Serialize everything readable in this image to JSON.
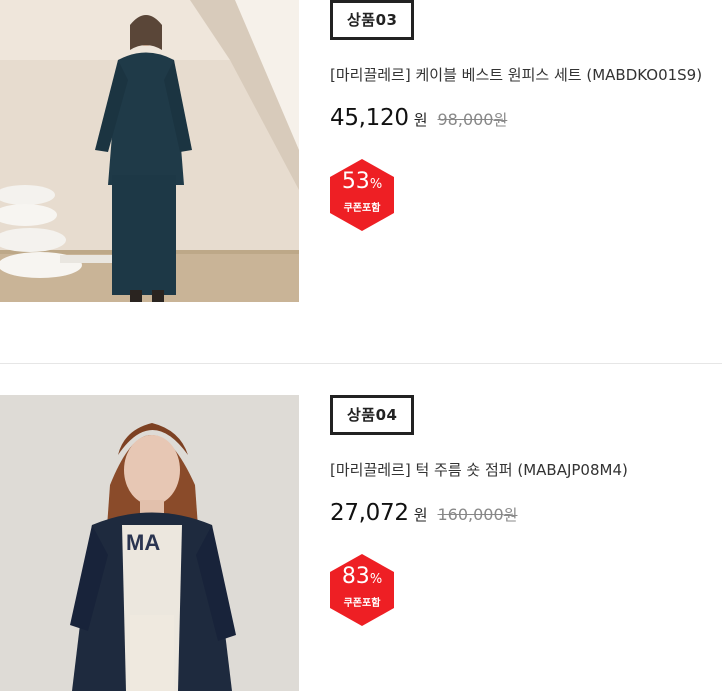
{
  "colors": {
    "discount_badge": "#ee1f24",
    "badge_border": "#222222",
    "divider": "#e6e6e6"
  },
  "products": [
    {
      "tag": "상품03",
      "name": "[마리끌레르] 케이블 베스트 원피스 세트 (MABDKO01S9)",
      "price": "45,120",
      "price_unit": "원",
      "original_price": "98,000",
      "original_unit": "원",
      "discount_value": "53",
      "discount_symbol": "%",
      "coupon_note": "쿠폰포함"
    },
    {
      "tag": "상품04",
      "name": "[마리끌레르] 턱 주름 숏 점퍼 (MABAJP08M4)",
      "price": "27,072",
      "price_unit": "원",
      "original_price": "160,000",
      "original_unit": "원",
      "discount_value": "83",
      "discount_symbol": "%",
      "coupon_note": "쿠폰포함"
    }
  ]
}
